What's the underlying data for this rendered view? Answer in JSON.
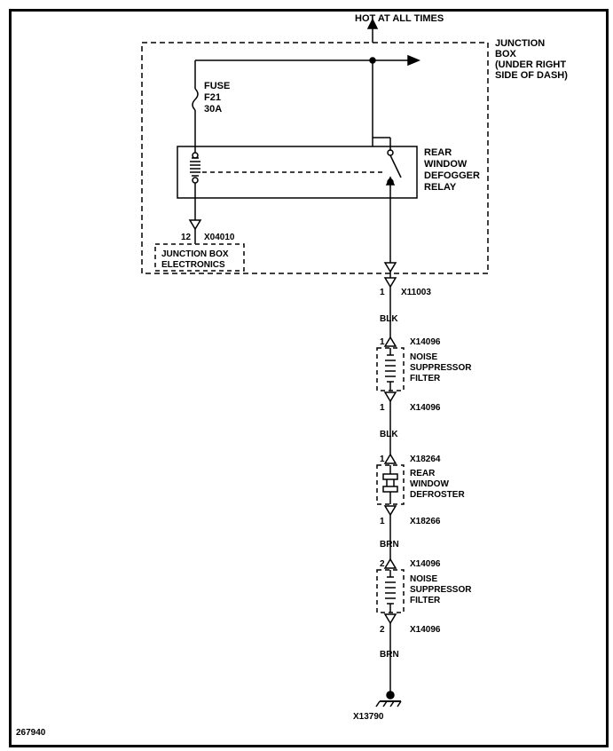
{
  "header": {
    "hot": "HOT AT ALL TIMES"
  },
  "junction_box_note": [
    "JUNCTION",
    "BOX",
    "(UNDER RIGHT",
    "SIDE OF DASH)"
  ],
  "fuse": {
    "l1": "FUSE",
    "l2": "F21",
    "l3": "30A"
  },
  "relay": [
    "REAR",
    "WINDOW",
    "DEFOGGER",
    "RELAY"
  ],
  "jbox_elec": {
    "pin": "12",
    "conn": "X04010",
    "l1": "JUNCTION BOX",
    "l2": "ELECTRONICS"
  },
  "c_x11003": {
    "pin": "1",
    "id": "X11003"
  },
  "wire_blk1": "BLK",
  "nsf1_top": {
    "pin": "1",
    "conn": "X14096"
  },
  "nsf": [
    "NOISE",
    "SUPPRESSOR",
    "FILTER"
  ],
  "nsf1_bot": {
    "pin": "1",
    "conn": "X14096"
  },
  "wire_blk2": "BLK",
  "defroster_top": {
    "pin": "1",
    "conn": "X18264"
  },
  "defroster": [
    "REAR",
    "WINDOW",
    "DEFROSTER"
  ],
  "defroster_bot": {
    "pin": "1",
    "conn": "X18266"
  },
  "wire_brn1": "BRN",
  "nsf2_top": {
    "pin": "2",
    "conn": "X14096"
  },
  "nsf2_bot": {
    "pin": "2",
    "conn": "X14096"
  },
  "wire_brn2": "BRN",
  "ground": "X13790",
  "docnum": "267940"
}
